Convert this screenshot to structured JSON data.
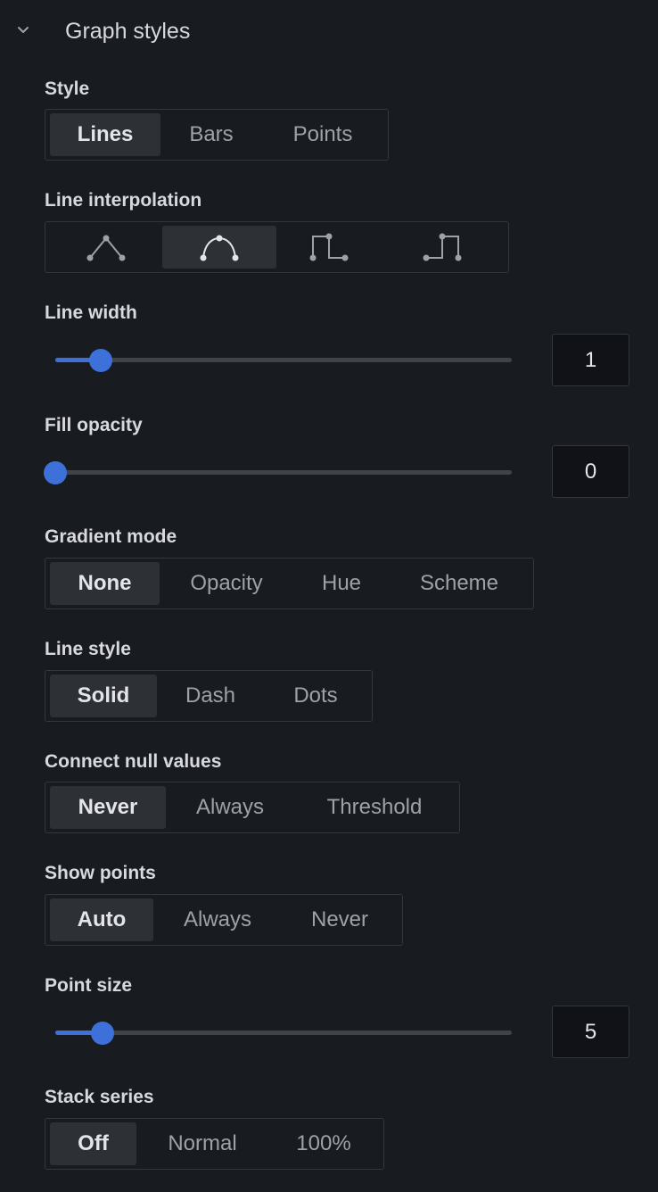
{
  "section": {
    "title": "Graph styles",
    "icon": "chevron-down-icon"
  },
  "style": {
    "label": "Style",
    "options": [
      "Lines",
      "Bars",
      "Points"
    ],
    "selected": "Lines"
  },
  "line_interpolation": {
    "label": "Line interpolation",
    "options": [
      "linear-icon",
      "smooth-icon",
      "step-before-icon",
      "step-after-icon"
    ],
    "selected": "smooth-icon"
  },
  "line_width": {
    "label": "Line width",
    "value": "1",
    "min": 0,
    "max": 10,
    "fraction": 0.1
  },
  "fill_opacity": {
    "label": "Fill opacity",
    "value": "0",
    "min": 0,
    "max": 100,
    "fraction": 0
  },
  "gradient_mode": {
    "label": "Gradient mode",
    "options": [
      "None",
      "Opacity",
      "Hue",
      "Scheme"
    ],
    "selected": "None"
  },
  "line_style": {
    "label": "Line style",
    "options": [
      "Solid",
      "Dash",
      "Dots"
    ],
    "selected": "Solid"
  },
  "connect_null_values": {
    "label": "Connect null values",
    "options": [
      "Never",
      "Always",
      "Threshold"
    ],
    "selected": "Never"
  },
  "show_points": {
    "label": "Show points",
    "options": [
      "Auto",
      "Always",
      "Never"
    ],
    "selected": "Auto"
  },
  "point_size": {
    "label": "Point size",
    "value": "5",
    "min": 1,
    "max": 40,
    "fraction": 0.103
  },
  "stack_series": {
    "label": "Stack series",
    "options": [
      "Off",
      "Normal",
      "100%"
    ],
    "selected": "Off"
  },
  "colors": {
    "accent": "#3d71d9",
    "background": "#181b1f",
    "active_button": "#2d3035"
  }
}
